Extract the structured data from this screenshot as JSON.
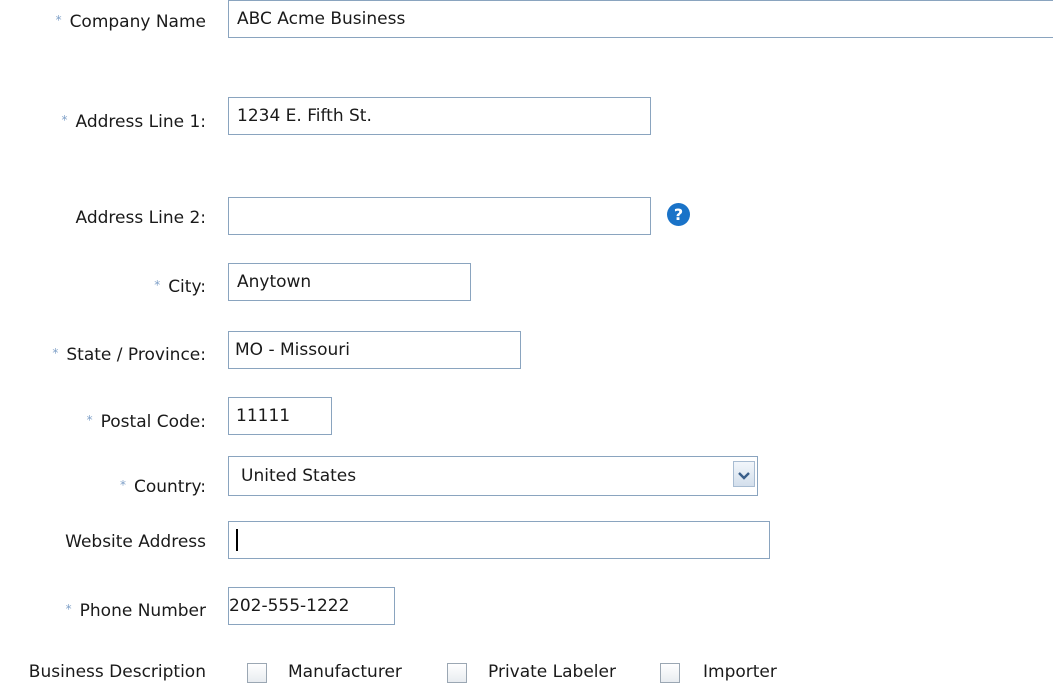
{
  "required_marker": "*",
  "form": {
    "company_name": {
      "label": "Company Name",
      "value": "ABC Acme Business"
    },
    "address1": {
      "label": "Address Line 1:",
      "value": "1234 E. Fifth St."
    },
    "address2": {
      "label": "Address Line 2:",
      "value": ""
    },
    "city": {
      "label": "City:",
      "value": "Anytown"
    },
    "state": {
      "label": "State / Province:",
      "value": "MO - Missouri"
    },
    "postal": {
      "label": "Postal Code:",
      "value": "11111"
    },
    "country": {
      "label": "Country:",
      "value": "United States"
    },
    "website": {
      "label": "Website Address",
      "value": ""
    },
    "phone": {
      "label": "Phone Number",
      "value": "202-555-1222"
    },
    "business": {
      "label": "Business Description",
      "options": [
        "Manufacturer",
        "Private Labeler",
        "Importer"
      ]
    }
  },
  "icons": {
    "help": "?",
    "help_color": "#1a73c8",
    "required_color": "#7fa0c8"
  }
}
